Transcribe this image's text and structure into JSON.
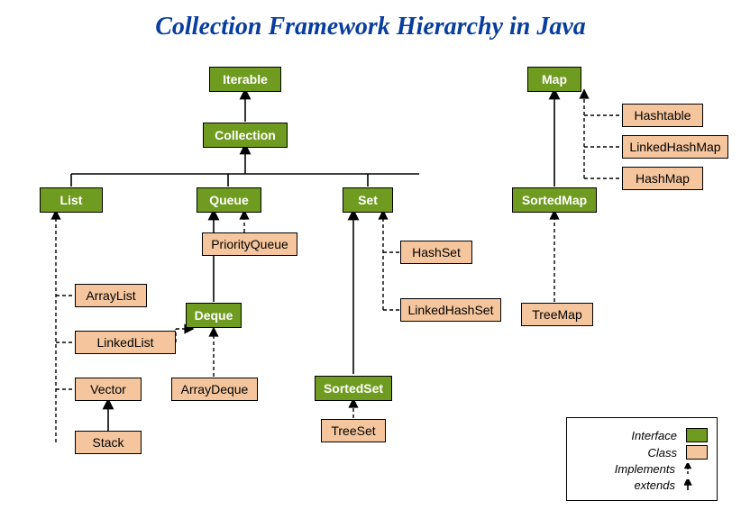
{
  "title": "Collection Framework Hierarchy in Java",
  "nodes": {
    "iterable": "Iterable",
    "collection": "Collection",
    "list": "List",
    "queue": "Queue",
    "set": "Set",
    "deque": "Deque",
    "sortedset": "SortedSet",
    "map": "Map",
    "sortedmap": "SortedMap",
    "arraylist": "ArrayList",
    "linkedlist": "LinkedList",
    "vector": "Vector",
    "stack": "Stack",
    "priorityqueue": "PriorityQueue",
    "arraydeque": "ArrayDeque",
    "hashset": "HashSet",
    "linkedhashset": "LinkedHashSet",
    "treeset": "TreeSet",
    "hashtable": "Hashtable",
    "linkedhashmap": "LinkedHashMap",
    "hashmap": "HashMap",
    "treemap": "TreeMap"
  },
  "legend": {
    "interface": "Interface",
    "class": "Class",
    "implements": "Implements",
    "extends": "extends"
  },
  "colors": {
    "interface": "#6f9c20",
    "class": "#f5c69d",
    "title": "#073d9e"
  }
}
